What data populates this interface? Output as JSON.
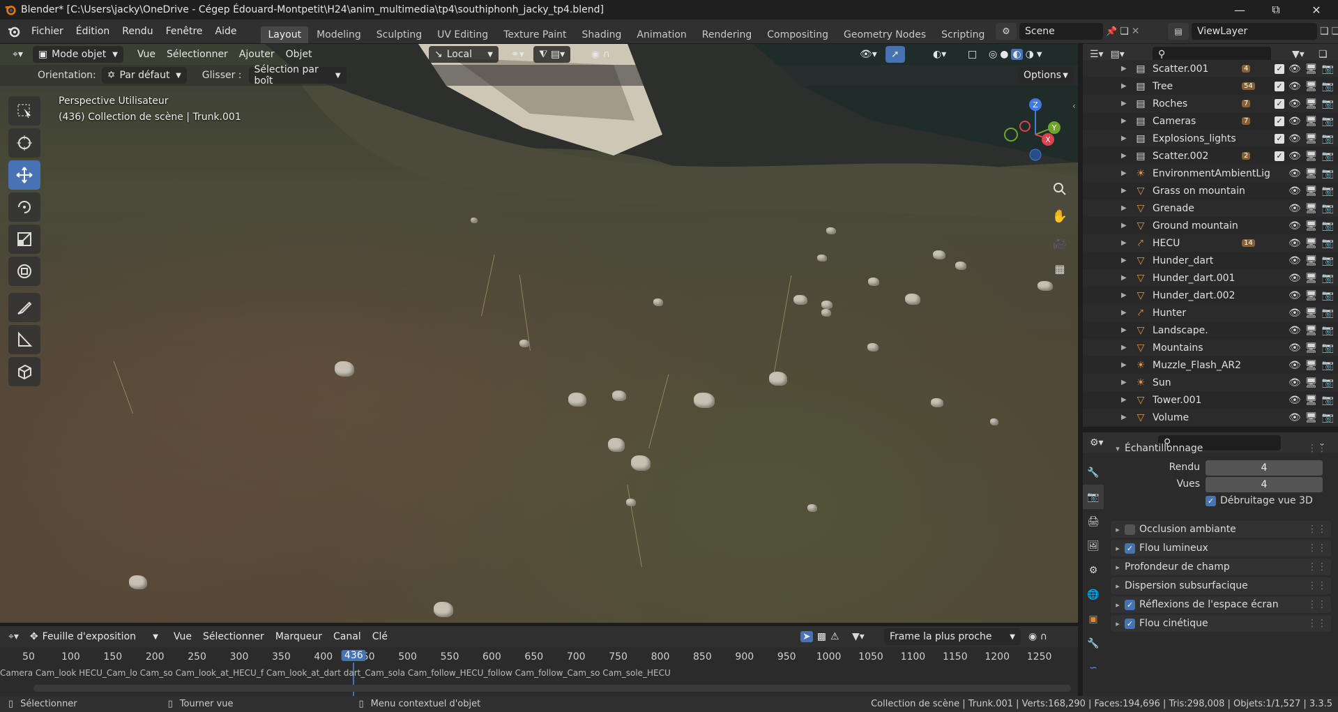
{
  "window": {
    "title": "Blender* [C:\\Users\\jacky\\OneDrive - Cégep Édouard-Montpetit\\H24\\anim_multimedia\\tp4\\southiphonh_jacky_tp4.blend]",
    "minimize_icon": "minimize-icon",
    "maximize_icon": "maximize-icon",
    "close_icon": "close-icon"
  },
  "menubar": {
    "menus": [
      "Fichier",
      "Édition",
      "Rendu",
      "Fenêtre",
      "Aide"
    ],
    "workspaces": [
      "Layout",
      "Modeling",
      "Sculpting",
      "UV Editing",
      "Texture Paint",
      "Shading",
      "Animation",
      "Rendering",
      "Compositing",
      "Geometry Nodes",
      "Scripting"
    ],
    "active_workspace": "Layout",
    "scene": "Scene",
    "view_layer": "ViewLayer"
  },
  "viewport": {
    "mode": "Mode objet",
    "menus": [
      "Vue",
      "Sélectionner",
      "Ajouter",
      "Objet"
    ],
    "transform_space": "Local",
    "orientation_label": "Orientation:",
    "orientation_value": "Par défaut",
    "drag_label": "Glisser :",
    "drag_value": "Sélection par boît",
    "options_label": "Options",
    "overlay_line1": "Perspective Utilisateur",
    "overlay_line2": "(436) Collection de scène | Trunk.001",
    "gizmo_axes": [
      "X",
      "Y",
      "Z"
    ]
  },
  "outliner": {
    "rows": [
      {
        "name": "Scatter.001",
        "type": "collection",
        "badge": "4",
        "checked": true
      },
      {
        "name": "Tree",
        "type": "collection",
        "badge": "54",
        "checked": true
      },
      {
        "name": "Roches",
        "type": "collection",
        "badge": "7",
        "checked": true
      },
      {
        "name": "Cameras",
        "type": "collection",
        "badge": "7",
        "checked": true
      },
      {
        "name": "Explosions_lights",
        "type": "collection",
        "badge": "",
        "checked": true
      },
      {
        "name": "Scatter.002",
        "type": "collection",
        "badge": "2",
        "checked": true
      },
      {
        "name": "EnvironmentAmbientLig",
        "type": "light",
        "badge": "",
        "checked": false
      },
      {
        "name": "Grass on mountain",
        "type": "mesh",
        "badge": "",
        "checked": false
      },
      {
        "name": "Grenade",
        "type": "mesh",
        "badge": "",
        "checked": false
      },
      {
        "name": "Ground mountain",
        "type": "mesh",
        "badge": "",
        "checked": false
      },
      {
        "name": "HECU",
        "type": "armature",
        "badge": "14",
        "checked": false
      },
      {
        "name": "Hunder_dart",
        "type": "mesh",
        "badge": "",
        "checked": false
      },
      {
        "name": "Hunder_dart.001",
        "type": "mesh",
        "badge": "",
        "checked": false
      },
      {
        "name": "Hunder_dart.002",
        "type": "mesh",
        "badge": "",
        "checked": false
      },
      {
        "name": "Hunter",
        "type": "armature",
        "badge": "",
        "checked": false
      },
      {
        "name": "Landscape.",
        "type": "mesh",
        "badge": "",
        "checked": false
      },
      {
        "name": "Mountains",
        "type": "mesh",
        "badge": "",
        "checked": false
      },
      {
        "name": "Muzzle_Flash_AR2",
        "type": "light",
        "badge": "",
        "checked": false
      },
      {
        "name": "Sun",
        "type": "light",
        "badge": "",
        "checked": false
      },
      {
        "name": "Tower.001",
        "type": "mesh",
        "badge": "",
        "checked": false
      },
      {
        "name": "Volume",
        "type": "mesh",
        "badge": "",
        "checked": false
      }
    ]
  },
  "properties": {
    "sampling_title": "Échantillonnage",
    "render_label": "Rendu",
    "render_value": "4",
    "viewport_label": "Vues",
    "viewport_value": "4",
    "denoise_label": "Débruitage vue 3D",
    "sections": [
      {
        "label": "Occlusion ambiante",
        "checked": false
      },
      {
        "label": "Flou lumineux",
        "checked": true
      },
      {
        "label": "Profondeur de champ",
        "checked": null
      },
      {
        "label": "Dispersion subsurfacique",
        "checked": null
      },
      {
        "label": "Réflexions de l'espace écran",
        "checked": true
      },
      {
        "label": "Flou cinétique",
        "checked": true
      }
    ]
  },
  "timeline": {
    "editor": "Feuille d'exposition",
    "menus": [
      "Vue",
      "Sélectionner",
      "Marqueur",
      "Canal",
      "Clé"
    ],
    "snap": "Frame la plus proche",
    "ticks": [
      "50",
      "100",
      "150",
      "200",
      "250",
      "300",
      "350",
      "400",
      "450",
      "500",
      "550",
      "600",
      "650",
      "700",
      "750",
      "800",
      "850",
      "900",
      "950",
      "1000",
      "1050",
      "1100",
      "1150",
      "1200",
      "1250"
    ],
    "current_frame": "436",
    "markers_text": "Camera Cam_look HECU_Cam_lo Cam_so Cam_look_at_HECU_f Cam_look_at_dart dart_Cam_sola Cam_follow_HECU_follow Cam_follow_Cam_so Cam_sole_HECU"
  },
  "statusbar": {
    "select": "Sélectionner",
    "rotate": "Tourner vue",
    "context": "Menu contextuel d'objet",
    "stats": "Collection de scène | Trunk.001 | Verts:168,290 | Faces:194,696 | Tris:298,008 | Objets:1/1,527 | 3.3.5"
  },
  "colors": {
    "accent": "#4772b3",
    "x_axis": "#e0404f",
    "y_axis": "#6fa32b",
    "z_axis": "#3e7be3"
  }
}
